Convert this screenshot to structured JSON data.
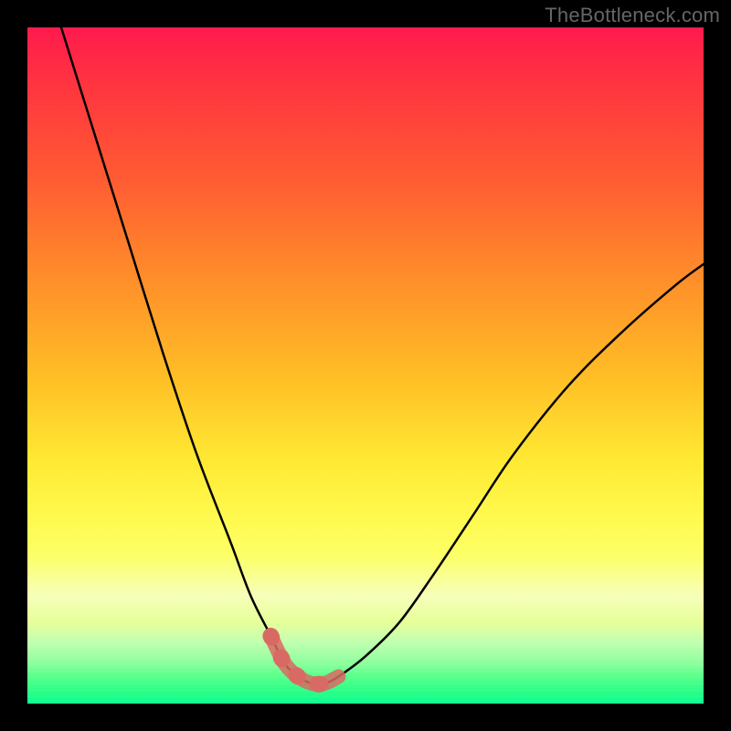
{
  "watermark": "TheBottleneck.com",
  "chart_data": {
    "type": "line",
    "title": "",
    "xlabel": "",
    "ylabel": "",
    "xlim": [
      0,
      100
    ],
    "ylim": [
      0,
      100
    ],
    "grid": false,
    "legend": false,
    "annotations": [],
    "series": [
      {
        "name": "bottleneck-curve",
        "x": [
          5,
          10,
          15,
          20,
          25,
          30,
          33,
          36,
          38,
          40,
          42,
          44,
          46,
          50,
          55,
          60,
          66,
          72,
          80,
          88,
          96,
          100
        ],
        "y": [
          100,
          84,
          68,
          52,
          37,
          24,
          16,
          10,
          6,
          4,
          3,
          3,
          4,
          7,
          12,
          19,
          28,
          37,
          47,
          55,
          62,
          65
        ]
      },
      {
        "name": "highlighted-range",
        "x": [
          36,
          38,
          40,
          42,
          44,
          46
        ],
        "y": [
          10,
          6,
          4,
          3,
          3,
          4
        ]
      }
    ],
    "gradient_meaning": "vertical color gradient from red (high bottleneck) through yellow to green (low bottleneck)"
  }
}
